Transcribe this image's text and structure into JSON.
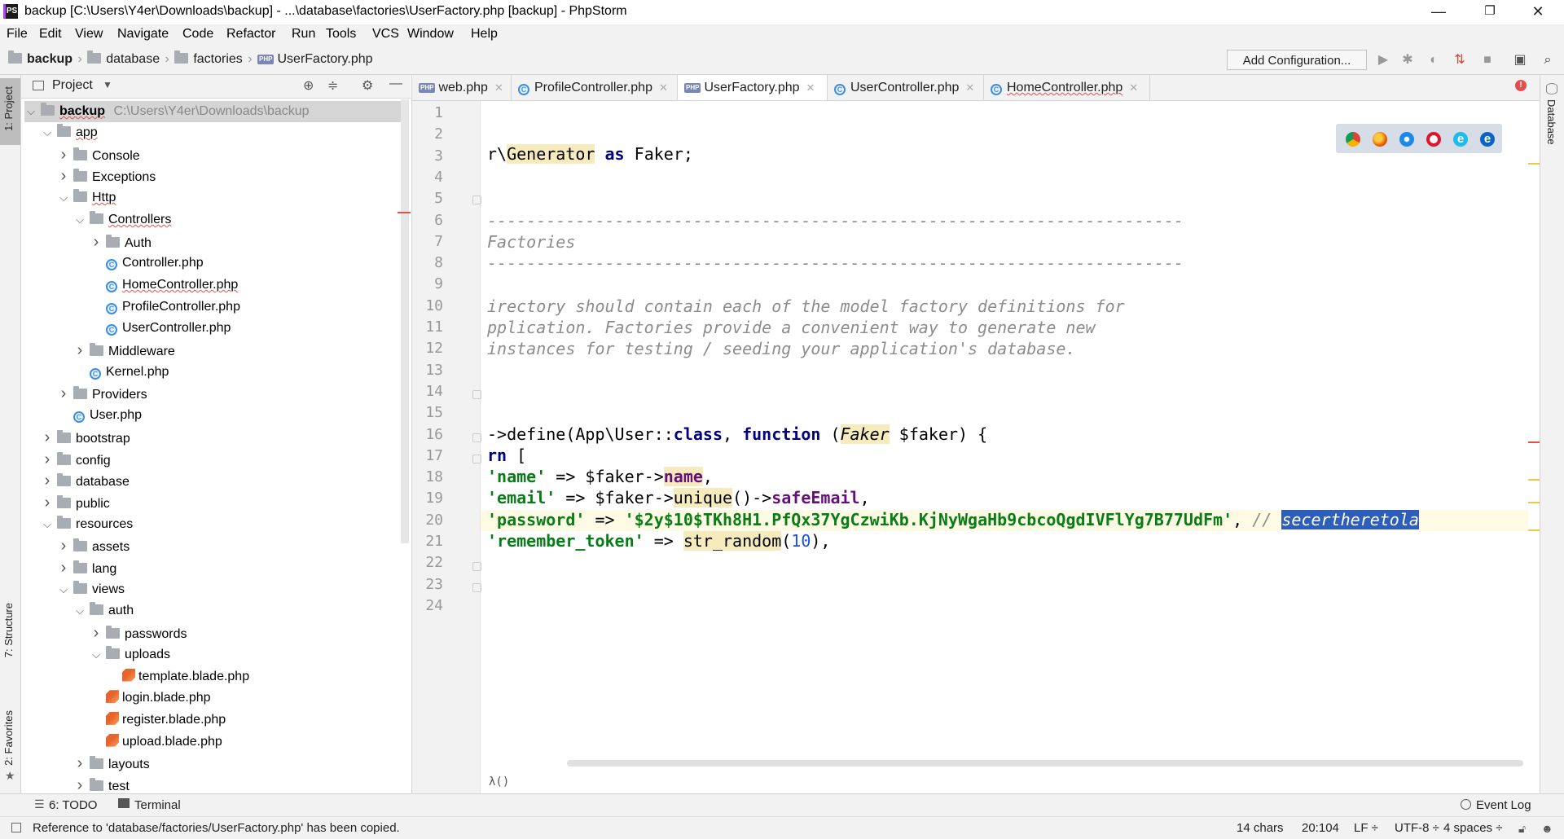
{
  "window": {
    "title": "backup [C:\\Users\\Y4er\\Downloads\\backup] - ...\\database\\factories\\UserFactory.php [backup] - PhpStorm",
    "logo_text": "PS",
    "minimize": "—",
    "restore": "❐",
    "close": "✕"
  },
  "menu": [
    "File",
    "Edit",
    "View",
    "Navigate",
    "Code",
    "Refactor",
    "Run",
    "Tools",
    "VCS",
    "Window",
    "Help"
  ],
  "breadcrumb": {
    "root": "backup",
    "items": [
      "database",
      "factories",
      "UserFactory.php"
    ]
  },
  "toolbar": {
    "add_configuration": "Add Configuration..."
  },
  "side_tabs": {
    "project": "1: Project",
    "structure": "7: Structure",
    "favorites": "2: Favorites",
    "database": "Database"
  },
  "project_panel": {
    "title": "Project",
    "root_name": "backup",
    "root_path": "C:\\Users\\Y4er\\Downloads\\backup",
    "tree": [
      {
        "label": "app",
        "type": "folder",
        "open": true
      },
      {
        "label": "Console",
        "type": "folder",
        "open": false
      },
      {
        "label": "Exceptions",
        "type": "folder",
        "open": false
      },
      {
        "label": "Http",
        "type": "folder",
        "open": true
      },
      {
        "label": "Controllers",
        "type": "folder",
        "open": true
      },
      {
        "label": "Auth",
        "type": "folder",
        "open": false
      },
      {
        "label": "Controller.php",
        "type": "class"
      },
      {
        "label": "HomeController.php",
        "type": "class"
      },
      {
        "label": "ProfileController.php",
        "type": "class"
      },
      {
        "label": "UserController.php",
        "type": "class"
      },
      {
        "label": "Middleware",
        "type": "folder",
        "open": false
      },
      {
        "label": "Kernel.php",
        "type": "class"
      },
      {
        "label": "Providers",
        "type": "folder",
        "open": false
      },
      {
        "label": "User.php",
        "type": "class"
      },
      {
        "label": "bootstrap",
        "type": "folder",
        "open": false
      },
      {
        "label": "config",
        "type": "folder",
        "open": false
      },
      {
        "label": "database",
        "type": "folder",
        "open": false
      },
      {
        "label": "public",
        "type": "folder",
        "open": false
      },
      {
        "label": "resources",
        "type": "folder",
        "open": true
      },
      {
        "label": "assets",
        "type": "folder",
        "open": false
      },
      {
        "label": "lang",
        "type": "folder",
        "open": false
      },
      {
        "label": "views",
        "type": "folder",
        "open": true
      },
      {
        "label": "auth",
        "type": "folder",
        "open": true
      },
      {
        "label": "passwords",
        "type": "folder",
        "open": false
      },
      {
        "label": "uploads",
        "type": "folder",
        "open": true
      },
      {
        "label": "template.blade.php",
        "type": "blade"
      },
      {
        "label": "login.blade.php",
        "type": "blade"
      },
      {
        "label": "register.blade.php",
        "type": "blade"
      },
      {
        "label": "upload.blade.php",
        "type": "blade"
      },
      {
        "label": "layouts",
        "type": "folder",
        "open": false
      },
      {
        "label": "test",
        "type": "folder",
        "open": false
      }
    ]
  },
  "tabs": [
    {
      "label": "web.php",
      "icon": "php-file-icon"
    },
    {
      "label": "ProfileController.php",
      "icon": "class-icon"
    },
    {
      "label": "UserFactory.php",
      "icon": "php-file-icon",
      "active": true
    },
    {
      "label": "UserController.php",
      "icon": "class-icon"
    },
    {
      "label": "HomeController.php",
      "icon": "class-icon"
    }
  ],
  "editor": {
    "line_numbers": [
      "1",
      "2",
      "3",
      "4",
      "5",
      "6",
      "7",
      "8",
      "9",
      "10",
      "11",
      "12",
      "13",
      "14",
      "15",
      "16",
      "17",
      "18",
      "19",
      "20",
      "21",
      "22",
      "23",
      "24"
    ],
    "current_line": 20,
    "bottom_breadcrumb": "λ()"
  },
  "bottom_tools": {
    "todo": "6: TODO",
    "terminal": "Terminal",
    "event_log": "Event Log"
  },
  "status": {
    "message": "Reference to 'database/factories/UserFactory.php' has been copied.",
    "chars": "14 chars",
    "position": "20:104",
    "line_sep": "LF ÷",
    "encoding": "UTF-8 ÷",
    "indent": "4 spaces ÷"
  },
  "colors": {
    "selection": "#2d5ebb",
    "string": "#067d17",
    "keyword": "#000080",
    "comment": "#8c8c8c",
    "caret_line": "#fffae3"
  }
}
